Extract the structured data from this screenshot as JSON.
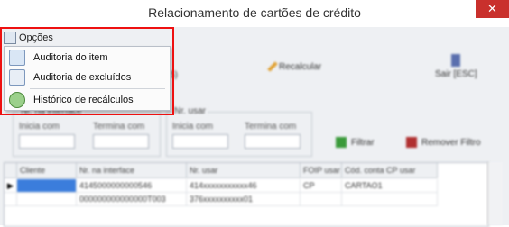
{
  "window": {
    "title": "Relacionamento de cartões de crédito",
    "close_label": "✕"
  },
  "menu": {
    "opcoes_label": "Opções",
    "items": [
      {
        "label": "Auditoria do item",
        "icon": "magnifier-doc-icon"
      },
      {
        "label": "Auditoria de excluídos",
        "icon": "doc-delete-icon"
      },
      {
        "label": "Histórico de recálculos",
        "icon": "history-icon"
      }
    ]
  },
  "toolbar": {
    "recalcular_label": "Recalcular",
    "sair_label": "Sair [ESC]",
    "hidden_shortcut": "5)"
  },
  "filters": {
    "group1_title": "Nr. na interface",
    "group2_title": "Nr. usar",
    "inicia_label": "Inicia com",
    "termina_label": "Termina com",
    "filtrar_label": "Filtrar",
    "remover_label": "Remover Filtro"
  },
  "grid": {
    "columns": [
      "Cliente",
      "Nr. na interface",
      "Nr. usar",
      "FOIP usar",
      "Cód. conta CP usar"
    ],
    "rows": [
      [
        "",
        "4145000000000546",
        "414xxxxxxxxxxx46",
        "CP",
        "CARTAO1"
      ],
      [
        "",
        "000000000000000T003",
        "376xxxxxxxxxx01",
        "",
        ""
      ]
    ]
  }
}
